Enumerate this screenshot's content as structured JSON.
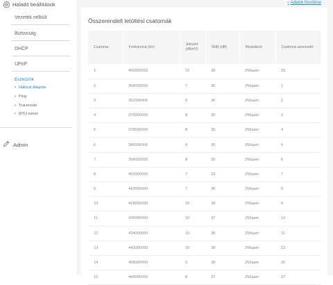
{
  "sidebar": {
    "header_label": "Haladó beállítások",
    "items": [
      "Vezeték nélküli",
      "Biztonság",
      "DHCP",
      "UPnP"
    ],
    "tools_label": "Eszközök",
    "tools": [
      "Hálózat állapota",
      "Ping",
      "Traceroute",
      "MTU méret"
    ],
    "admin_label": "Admin"
  },
  "main": {
    "help_link": "Adatok frissítése",
    "title": "Összerendelt letöltési csatornák"
  },
  "table": {
    "headers": [
      "Csatorna",
      "Frekvencia (Hz)",
      "Jelszint (dBmV)",
      "SNR (dB)",
      "Moduláció",
      "Csatorna azonosító"
    ],
    "rows": [
      [
        "1",
        "450000000",
        "10",
        "38",
        "256qam",
        "25"
      ],
      [
        "2",
        "354000000",
        "7",
        "36",
        "256qam",
        "1"
      ],
      [
        "3",
        "362000000",
        "8",
        "36",
        "256qam",
        "2"
      ],
      [
        "4",
        "370000000",
        "8",
        "35",
        "256qam",
        "3"
      ],
      [
        "5",
        "378000000",
        "8",
        "35",
        "256qam",
        "4"
      ],
      [
        "6",
        "386000000",
        "8",
        "35",
        "256qam",
        "5"
      ],
      [
        "7",
        "394000000",
        "8",
        "35",
        "256qam",
        "6"
      ],
      [
        "8",
        "402000000",
        "7",
        "33",
        "256qam",
        "7"
      ],
      [
        "9",
        "410000000",
        "7",
        "36",
        "256qam",
        "8"
      ],
      [
        "10",
        "418000000",
        "10",
        "38",
        "256qam",
        "9"
      ],
      [
        "11",
        "426000000",
        "10",
        "37",
        "256qam",
        "10"
      ],
      [
        "12",
        "434000000",
        "10",
        "38",
        "256qam",
        "11"
      ],
      [
        "13",
        "442000000",
        "10",
        "38",
        "256qam",
        "12"
      ],
      [
        "14",
        "458000000",
        "9",
        "38",
        "256qam",
        "26"
      ],
      [
        "15",
        "466000000",
        "8",
        "37",
        "256qam",
        "27"
      ]
    ]
  },
  "colors": {
    "accent": "#1b8fc9",
    "background": "#f5f5f5",
    "text": "#555555"
  }
}
